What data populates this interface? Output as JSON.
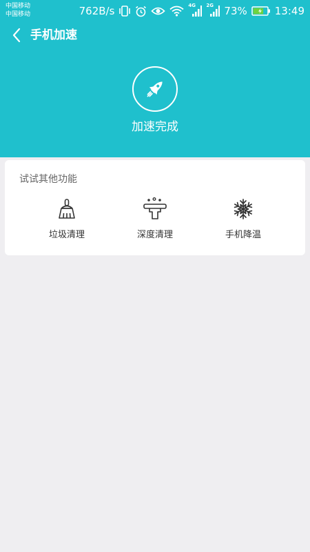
{
  "status_bar": {
    "carrier_1": "中国移动",
    "carrier_2": "中国移动",
    "net_speed": "762B/s",
    "signal_1_tag": "4G",
    "signal_2_tag": "2G",
    "battery_percent": "73%",
    "battery_level": 0.73,
    "time": "13:49"
  },
  "header": {
    "title": "手机加速",
    "back_icon": "chevron-left-icon",
    "background_color": "#1fc0cd"
  },
  "result": {
    "icon": "rocket-icon",
    "text": "加速完成"
  },
  "other_features": {
    "title": "试试其他功能",
    "items": [
      {
        "label": "垃圾清理",
        "icon": "broom-icon"
      },
      {
        "label": "深度清理",
        "icon": "deep-clean-icon"
      },
      {
        "label": "手机降温",
        "icon": "snowflake-icon"
      }
    ]
  }
}
